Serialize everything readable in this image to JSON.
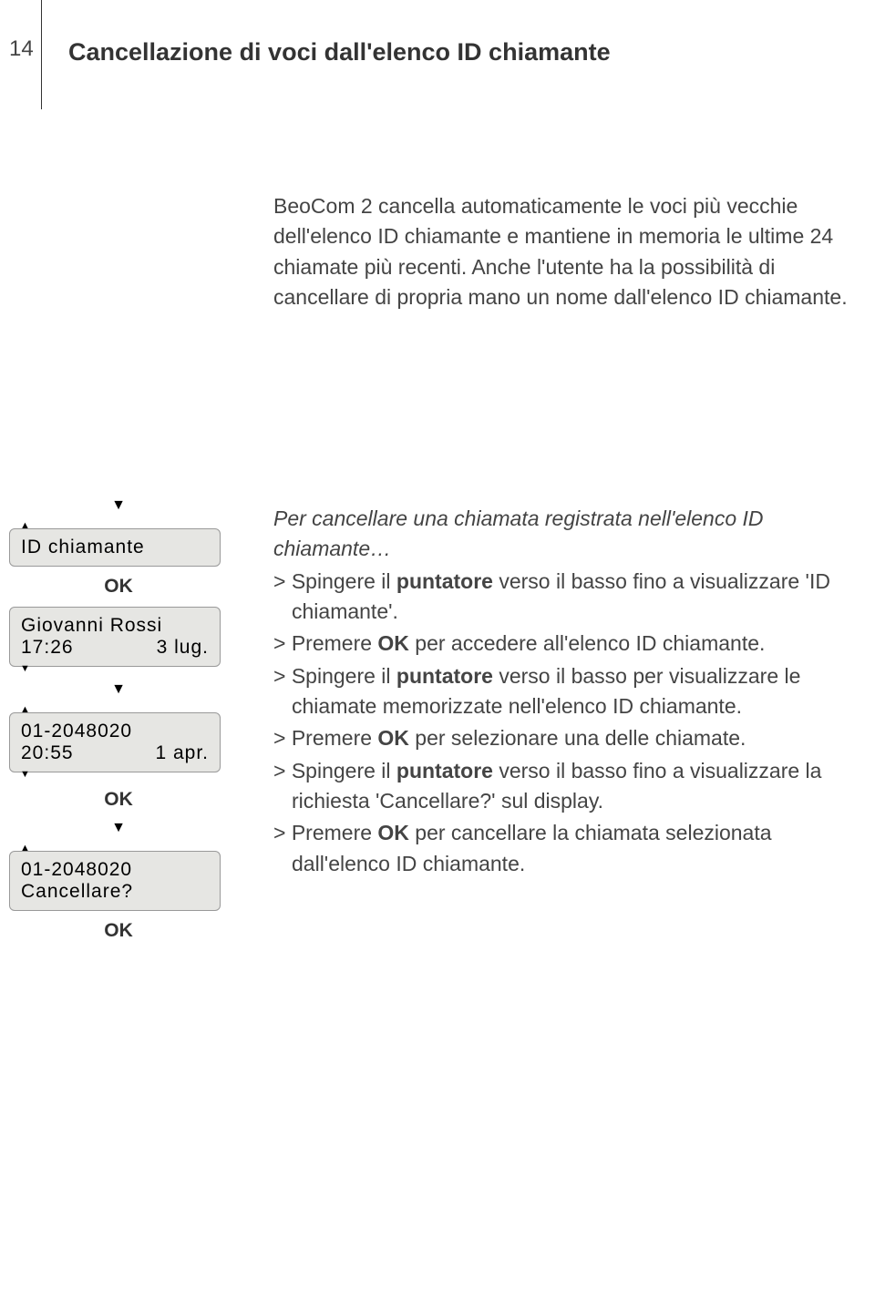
{
  "page_number": "14",
  "heading": "Cancellazione di voci dall'elenco ID chiamante",
  "intro": "BeoCom 2 cancella automaticamente le voci più vecchie dell'elenco ID chiamante e mantiene in memoria le ultime 24 chiamate più recenti. Anche l'utente ha la possibilità di cancellare di propria mano un nome dall'elenco ID chiamante.",
  "subheading": "Per cancellare una chiamata registrata nell'elenco ID chiamante…",
  "steps": [
    {
      "pre": "> Spingere il ",
      "bold": "puntatore",
      "post": " verso il basso fino a visualizzare 'ID chiamante'."
    },
    {
      "pre": "> Premere ",
      "bold": "OK",
      "post": " per accedere all'elenco ID chiamante."
    },
    {
      "pre": "> Spingere il ",
      "bold": "puntatore",
      "post": " verso il basso per visualizzare le chiamate memorizzate nell'elenco ID chiamante."
    },
    {
      "pre": "> Premere ",
      "bold": "OK",
      "post": " per selezionare una delle chiamate."
    },
    {
      "pre": "> Spingere il ",
      "bold": "puntatore",
      "post": " verso il basso fino a visualizzare la richiesta 'Cancellare?' sul display."
    },
    {
      "pre": "> Premere ",
      "bold": "OK",
      "post": " per cancellare la chiamata selezionata dall'elenco ID chiamante."
    }
  ],
  "lcd1_line1": "ID chiamante",
  "ok_label": "OK",
  "lcd2_line1": "Giovanni Rossi",
  "lcd2_time": "17:26",
  "lcd2_date": "3 lug.",
  "lcd3_line1": "01-2048020",
  "lcd3_time": "20:55",
  "lcd3_date": "1 apr.",
  "lcd4_line1": "01-2048020",
  "lcd4_line2": "Cancellare?"
}
